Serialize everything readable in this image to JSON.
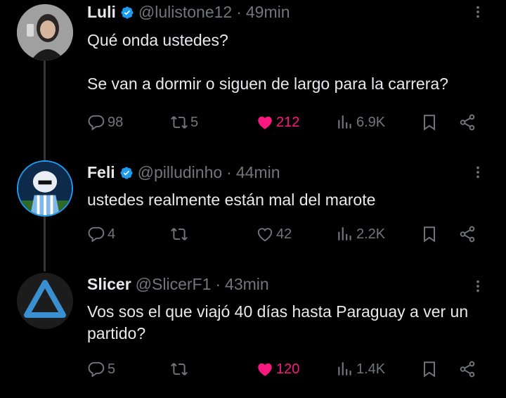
{
  "tweets": [
    {
      "name": "Luli",
      "handle": "@lulistone12",
      "time": "49min",
      "text": "Qué onda ustedes?\n\nSe van a dormir o siguen de largo para la carrera?",
      "replies": "98",
      "retweets": "5",
      "likes": "212",
      "liked": true,
      "views": "6.9K",
      "verified": true
    },
    {
      "name": "Feli",
      "handle": "@pilludinho",
      "time": "44min",
      "text": "ustedes realmente están mal del marote",
      "replies": "4",
      "retweets": "",
      "likes": "42",
      "liked": false,
      "views": "2.2K",
      "verified": true
    },
    {
      "name": "Slicer",
      "handle": "@SlicerF1",
      "time": "43min",
      "text": "Vos sos el que viajó 40 días hasta Paraguay a ver un partido?",
      "replies": "5",
      "retweets": "",
      "likes": "120",
      "liked": true,
      "views": "1.4K",
      "verified": false
    }
  ],
  "separator": "·",
  "colors": {
    "accent_like": "#f91880",
    "verified_blue": "#1d9bf0",
    "muted": "#71767b"
  },
  "icons": [
    "verified-icon",
    "more-icon",
    "reply-icon",
    "retweet-icon",
    "like-icon",
    "views-icon",
    "bookmark-icon",
    "share-icon"
  ]
}
